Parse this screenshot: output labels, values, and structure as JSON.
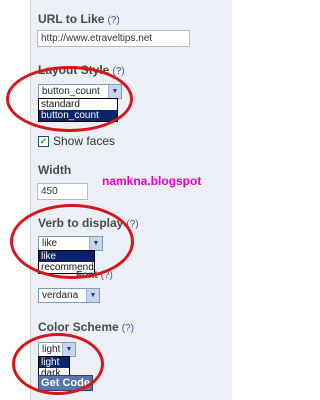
{
  "url": {
    "label": "URL to Like",
    "help": "(?)",
    "value": "http://www.etraveltips.net"
  },
  "layout": {
    "label": "Layout Style",
    "help": "(?)",
    "selected": "button_count",
    "options": [
      "standard",
      "button_count"
    ]
  },
  "faces": {
    "label": "Show faces"
  },
  "width": {
    "label": "Width",
    "help": "(?)",
    "value": "450"
  },
  "watermark": "namkna.blogspot",
  "verb": {
    "label": "Verb to display",
    "help": "(?)",
    "selected": "like",
    "options": [
      "like",
      "recommend"
    ]
  },
  "font": {
    "label": "Font",
    "help": "(?)",
    "selected": "verdana"
  },
  "color": {
    "label": "Color Scheme",
    "help": "(?)",
    "selected": "light",
    "options": [
      "light",
      "dark"
    ]
  },
  "get_code": "Get Code",
  "colors": {
    "panel": "#eceff5",
    "highlight": "#0a246a",
    "circle": "#d6161b",
    "watermark": "#e600c8",
    "button": "#5b74a8"
  }
}
